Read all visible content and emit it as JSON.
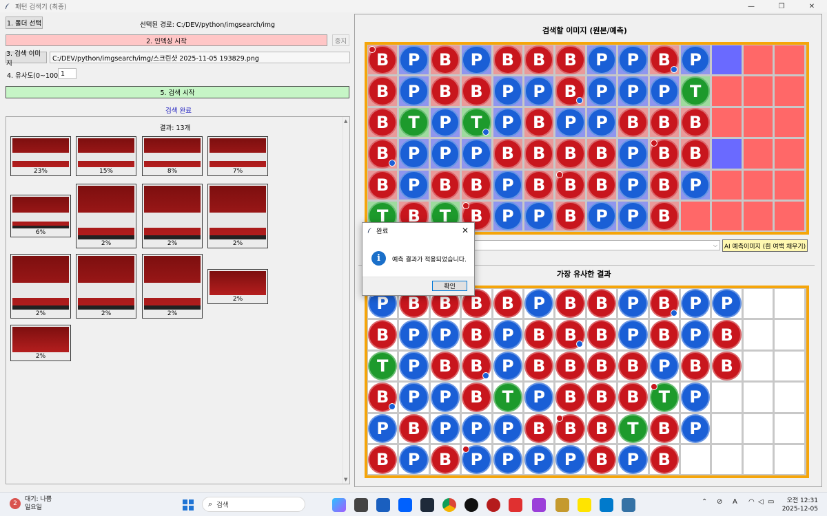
{
  "window": {
    "title": "패턴 검색기 (최종)",
    "minimize": "—",
    "restore": "❐",
    "close": "✕"
  },
  "left": {
    "folder_button": "1. 폴더 선택",
    "selected_path": "선택된 경로: C:/DEV/python/imgsearch/img",
    "index_button": "2. 인덱싱 시작",
    "stop_button": "중지",
    "search_image_button": "3. 검색 이미지",
    "search_image_path": "C:/DEV/python/imgsearch/img/스크린샷 2025-11-05 193829.png",
    "similarity_label": "4. 유사도(0~100):",
    "similarity_value": "1",
    "search_button": "5. 검색 시작",
    "search_status": "검색 완료",
    "result_count": "결과: 13개",
    "results": [
      "23%",
      "15%",
      "8%",
      "7%",
      "6%",
      "2%",
      "2%",
      "2%",
      "2%",
      "2%",
      "2%",
      "2%",
      "2%"
    ]
  },
  "right": {
    "top_title": "검색할 이미지 (원본/예측)",
    "ai_button": "AI 예측이미지 (흰 여백 채우기)",
    "bottom_title": "가장 유사한 결과",
    "top_board": [
      [
        "B",
        "B",
        "B",
        "B",
        "B",
        "T"
      ],
      [
        "P",
        "P",
        "T",
        "P",
        "P",
        "B"
      ],
      [
        "B",
        "B",
        "P",
        "P",
        "B",
        "T"
      ],
      [
        "P",
        "B",
        "T",
        "P",
        "B",
        "B"
      ],
      [
        "B",
        "P",
        "P",
        "B",
        "P",
        "P"
      ],
      [
        "B",
        "P",
        "B",
        "B",
        "B",
        "P"
      ],
      [
        "B",
        "B",
        "P",
        "B",
        "B",
        "B"
      ],
      [
        "P",
        "P",
        "P",
        "B",
        "B",
        "P"
      ],
      [
        "P",
        "P",
        "B",
        "P",
        "P",
        "P"
      ],
      [
        "B",
        "P",
        "B",
        "B",
        "B",
        "B"
      ],
      [
        "P",
        "T",
        "B",
        "B",
        "P",
        "-"
      ]
    ],
    "bottom_board": [
      [
        "P",
        "B",
        "T",
        "B",
        "P",
        "B"
      ],
      [
        "B",
        "P",
        "P",
        "P",
        "B",
        "P"
      ],
      [
        "B",
        "P",
        "B",
        "P",
        "P",
        "B"
      ],
      [
        "B",
        "B",
        "B",
        "B",
        "P",
        "P"
      ],
      [
        "B",
        "P",
        "P",
        "T",
        "P",
        "P"
      ],
      [
        "P",
        "B",
        "B",
        "P",
        "B",
        "P"
      ],
      [
        "B",
        "B",
        "B",
        "B",
        "B",
        "P"
      ],
      [
        "B",
        "B",
        "B",
        "B",
        "B",
        "B"
      ],
      [
        "P",
        "P",
        "B",
        "B",
        "T",
        "P"
      ],
      [
        "B",
        "B",
        "P",
        "T",
        "B",
        "B"
      ],
      [
        "P",
        "P",
        "B",
        "P",
        "P",
        "-"
      ],
      [
        "P",
        "B",
        "B",
        "-",
        "-",
        "-"
      ]
    ],
    "colors": {
      "B": "#c8161d",
      "P": "#1a5fd6",
      "T": "#1d9a2c",
      "border": "#f5a50a",
      "predict_red": "#ff6868",
      "predict_blue": "#6a6aff"
    }
  },
  "dialog": {
    "title": "완료",
    "message": "예측 결과가 적용되었습니다.",
    "ok": "확인"
  },
  "taskbar": {
    "weather_line1": "대기: 나쁨",
    "weather_line2": "일요일",
    "weather_badge": "2",
    "search_placeholder": "검색",
    "tray_lang": "A",
    "clock_time": "오전 12:31",
    "clock_date": "2025-12-05"
  }
}
